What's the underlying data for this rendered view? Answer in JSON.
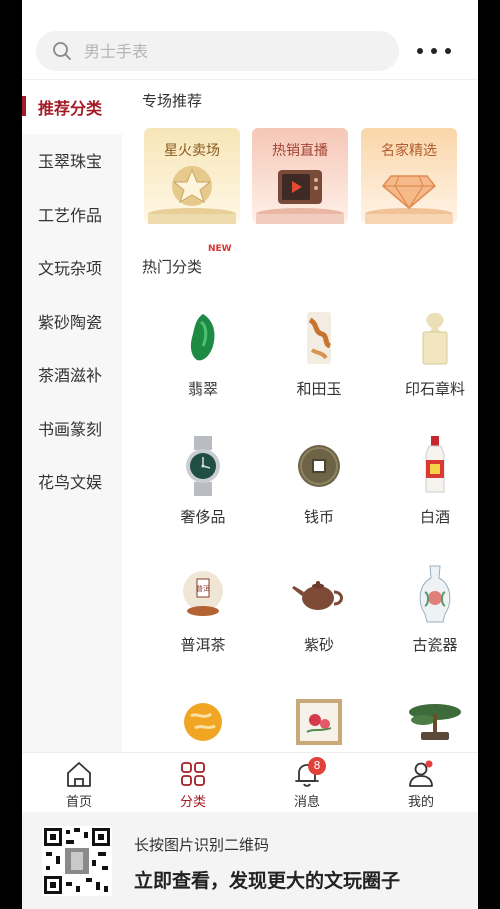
{
  "search": {
    "placeholder": "男士手表"
  },
  "sidebar": {
    "items": [
      {
        "label": "推荐分类",
        "active": true
      },
      {
        "label": "玉翠珠宝"
      },
      {
        "label": "工艺作品"
      },
      {
        "label": "文玩杂项"
      },
      {
        "label": "紫砂陶瓷"
      },
      {
        "label": "茶酒滋补"
      },
      {
        "label": "书画篆刻"
      },
      {
        "label": "花鸟文娱"
      }
    ]
  },
  "main": {
    "special_title": "专场推荐",
    "specials": [
      {
        "label": "星火卖场",
        "icon": "star-trophy-icon"
      },
      {
        "label": "热销直播",
        "icon": "tv-live-icon"
      },
      {
        "label": "名家精选",
        "icon": "diamond-icon"
      }
    ],
    "hot_title": "热门分类",
    "new_tag": "NEW",
    "categories": [
      {
        "label": "翡翠",
        "icon": "jade-pendant-icon"
      },
      {
        "label": "和田玉",
        "icon": "hetian-jade-icon"
      },
      {
        "label": "印石章料",
        "icon": "seal-stone-icon"
      },
      {
        "label": "奢侈品",
        "icon": "watch-icon"
      },
      {
        "label": "钱币",
        "icon": "coin-icon"
      },
      {
        "label": "白酒",
        "icon": "liquor-bottle-icon"
      },
      {
        "label": "普洱茶",
        "icon": "puer-tea-icon"
      },
      {
        "label": "紫砂",
        "icon": "teapot-icon"
      },
      {
        "label": "古瓷器",
        "icon": "porcelain-vase-icon"
      },
      {
        "label": "",
        "icon": "amber-bead-icon"
      },
      {
        "label": "",
        "icon": "painting-icon"
      },
      {
        "label": "",
        "icon": "bonsai-icon"
      }
    ]
  },
  "tabbar": {
    "tabs": [
      {
        "label": "首页",
        "icon": "home-icon"
      },
      {
        "label": "分类",
        "icon": "category-icon",
        "active": true
      },
      {
        "label": "消息",
        "icon": "bell-icon",
        "badge": "8"
      },
      {
        "label": "我的",
        "icon": "user-icon"
      }
    ]
  },
  "banner": {
    "line1": "长按图片识别二维码",
    "line2": "立即查看，发现更大的文玩圈子"
  },
  "colors": {
    "accent": "#a31c25",
    "badge": "#e0413b"
  }
}
